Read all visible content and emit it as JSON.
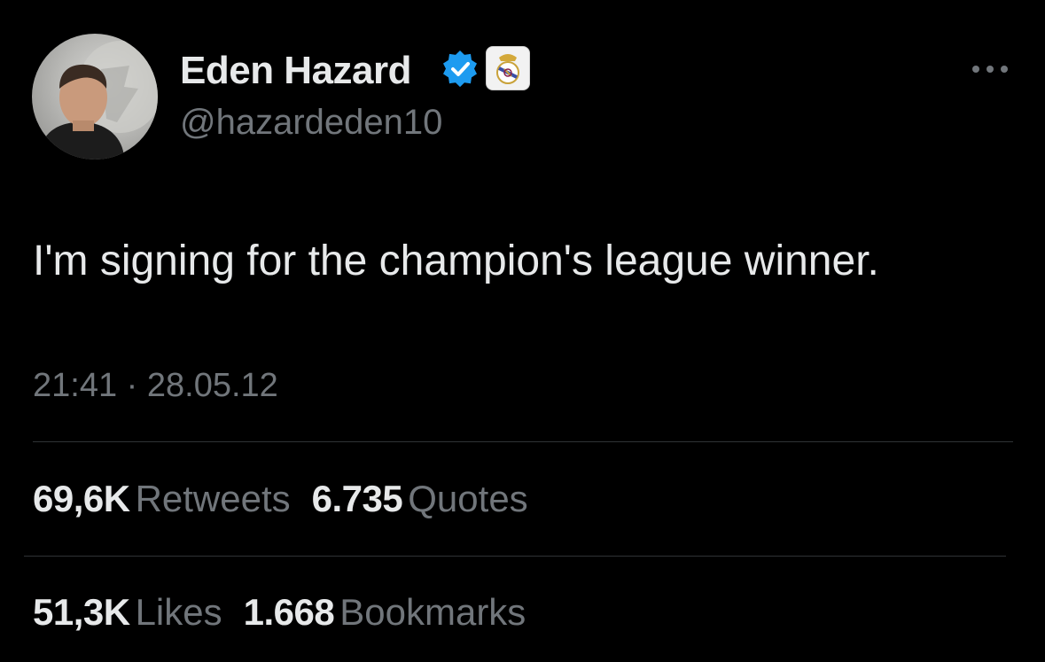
{
  "author": {
    "display_name": "Eden Hazard",
    "handle": "@hazardeden10",
    "verified": true,
    "verified_color": "#1d9bf0"
  },
  "tweet": {
    "text": "I'm signing for the champion's league winner.",
    "time": "21:41",
    "separator": "·",
    "date": "28.05.12"
  },
  "stats": {
    "retweets_count": "69,6K",
    "retweets_label": "Retweets",
    "quotes_count": "6.735",
    "quotes_label": "Quotes",
    "likes_count": "51,3K",
    "likes_label": "Likes",
    "bookmarks_count": "1.668",
    "bookmarks_label": "Bookmarks"
  },
  "colors": {
    "background": "#000000",
    "primary_text": "#e7e9ea",
    "secondary_text": "#71767b",
    "divider": "#2f3336"
  },
  "icons": {
    "verified": "verified-badge-icon",
    "affiliate": "real-madrid-crest-icon",
    "more": "more-horizontal-icon"
  }
}
